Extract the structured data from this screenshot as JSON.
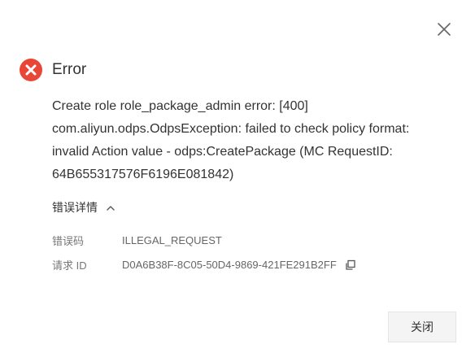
{
  "dialog": {
    "title": "Error",
    "message_lines": [
      "Create role role_package_admin error: [400]",
      "com.aliyun.odps.OdpsException: failed to check policy format:",
      "invalid Action value - odps:CreatePackage (MC RequestID:",
      "64B655317576F6196E081842)"
    ],
    "details_toggle_label": "错误详情",
    "details": [
      {
        "label": "错误码",
        "value": "ILLEGAL_REQUEST"
      },
      {
        "label": "请求 ID",
        "value": "D0A6B38F-8C05-50D4-9869-421FE291B2FF"
      }
    ],
    "close_button_label": "关闭"
  },
  "icons": {
    "close": "close-icon",
    "error": "error-icon",
    "chevron": "chevron-up-icon",
    "copy": "copy-icon"
  },
  "colors": {
    "error_red": "#e84738",
    "text_primary": "#333333",
    "text_secondary": "#777777",
    "button_bg": "#f4f4f4",
    "button_border": "#e5e5e5"
  }
}
